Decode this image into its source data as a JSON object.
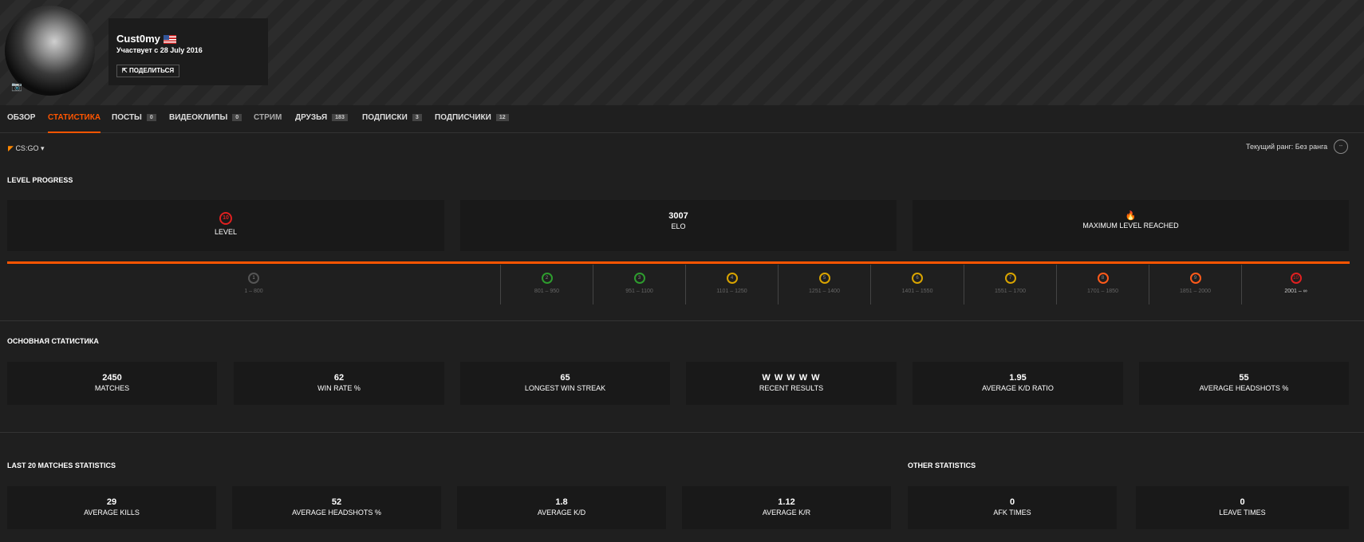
{
  "profile": {
    "username": "Cust0my",
    "member_since": "Участвует с 28 July 2016",
    "share_label": "ПОДЕЛИТЬСЯ"
  },
  "nav": [
    {
      "label": "ОБЗОР"
    },
    {
      "label": "СТАТИСТИКА",
      "active": true
    },
    {
      "label": "ПОСТЫ",
      "count": "0"
    },
    {
      "label": "ВИДЕОКЛИПЫ",
      "count": "0"
    },
    {
      "label": "СТРИМ"
    },
    {
      "label": "ДРУЗЬЯ",
      "count": "183"
    },
    {
      "label": "ПОДПИСКИ",
      "count": "3"
    },
    {
      "label": "ПОДПИСЧИКИ",
      "count": "12"
    }
  ],
  "game_selector": "CS:GO",
  "current_rank": "Текущий ранг: Без ранга",
  "rank_icon_text": "--",
  "level_progress": {
    "title": "LEVEL PROGRESS",
    "level": {
      "value": "10",
      "label": "LEVEL"
    },
    "elo": {
      "value": "3007",
      "label": "ELO"
    },
    "max": {
      "label": "MAXIMUM LEVEL REACHED"
    },
    "levels": [
      {
        "num": "1",
        "range": "1 – 800",
        "color": "#cccccc"
      },
      {
        "num": "2",
        "range": "801 – 950",
        "color": "#2e9c2e"
      },
      {
        "num": "3",
        "range": "951 – 1100",
        "color": "#2e9c2e"
      },
      {
        "num": "4",
        "range": "1101 – 1250",
        "color": "#d9a400"
      },
      {
        "num": "5",
        "range": "1251 – 1400",
        "color": "#d9a400"
      },
      {
        "num": "6",
        "range": "1401 – 1550",
        "color": "#d9a400"
      },
      {
        "num": "7",
        "range": "1551 – 1700",
        "color": "#d9a400"
      },
      {
        "num": "8",
        "range": "1701 – 1850",
        "color": "#ff5a1a"
      },
      {
        "num": "9",
        "range": "1851 – 2000",
        "color": "#ff5a1a"
      },
      {
        "num": "10",
        "range": "2001 – ∞",
        "color": "#e02020",
        "current": true
      }
    ]
  },
  "main_stats": {
    "title": "ОСНОВНАЯ СТАТИСТИКА",
    "items": [
      {
        "value": "2450",
        "label": "MATCHES"
      },
      {
        "value": "62",
        "label": "WIN RATE %"
      },
      {
        "value": "65",
        "label": "LONGEST WIN STREAK"
      },
      {
        "value": "W W W W W",
        "label": "RECENT RESULTS"
      },
      {
        "value": "1.95",
        "label": "AVERAGE K/D RATIO"
      },
      {
        "value": "55",
        "label": "AVERAGE HEADSHOTS %"
      }
    ]
  },
  "last20": {
    "title": "LAST 20 MATCHES STATISTICS",
    "items": [
      {
        "value": "29",
        "label": "AVERAGE KILLS"
      },
      {
        "value": "52",
        "label": "AVERAGE HEADSHOTS %"
      },
      {
        "value": "1.8",
        "label": "AVERAGE K/D"
      },
      {
        "value": "1.12",
        "label": "AVERAGE K/R"
      }
    ]
  },
  "other": {
    "title": "OTHER STATISTICS",
    "items": [
      {
        "value": "0",
        "label": "AFK TIMES"
      },
      {
        "value": "0",
        "label": "LEAVE TIMES"
      }
    ]
  },
  "colors": {
    "accent": "#ff5500",
    "win": "#3fbf3f"
  }
}
